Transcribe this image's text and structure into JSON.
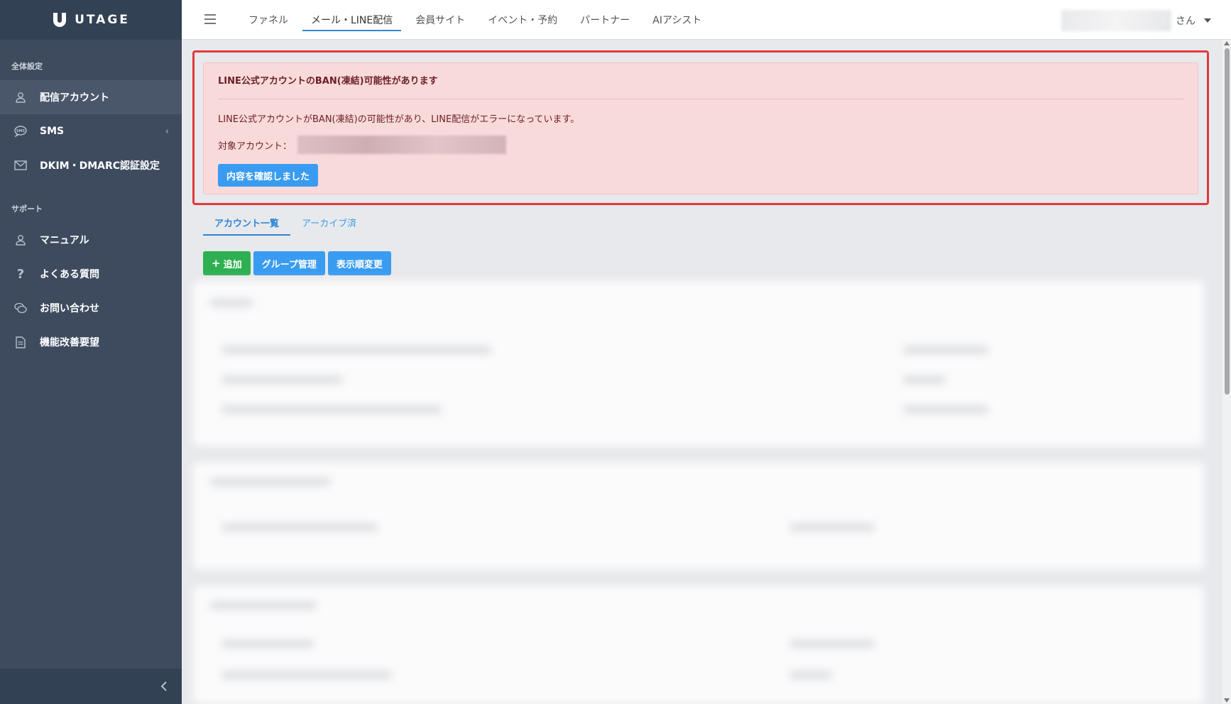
{
  "app": {
    "logo_text": "UTAGE"
  },
  "sidebar": {
    "section_general": "全体設定",
    "section_support": "サポート",
    "items": [
      {
        "label": "配信アカウント",
        "icon": "user-icon",
        "active": true
      },
      {
        "label": "SMS",
        "icon": "sms-icon"
      },
      {
        "label": "DKIM・DMARC認証設定",
        "icon": "envelope-icon"
      },
      {
        "label": "マニュアル",
        "icon": "user-icon"
      },
      {
        "label": "よくある質問",
        "icon": "question-icon"
      },
      {
        "label": "お問い合わせ",
        "icon": "chat-icon"
      },
      {
        "label": "機能改善要望",
        "icon": "document-icon"
      }
    ]
  },
  "header": {
    "nav": [
      {
        "label": "ファネル"
      },
      {
        "label": "メール・LINE配信",
        "active": true
      },
      {
        "label": "会員サイト"
      },
      {
        "label": "イベント・予約"
      },
      {
        "label": "パートナー"
      },
      {
        "label": "AIアシスト"
      }
    ],
    "user_suffix": "さん"
  },
  "alert": {
    "title": "LINE公式アカウントのBAN(凍結)可能性があります",
    "message": "LINE公式アカウントがBAN(凍結)の可能性があり、LINE配信がエラーになっています。",
    "account_label": "対象アカウント：",
    "confirm_button": "内容を確認しました"
  },
  "tabs": [
    {
      "label": "アカウント一覧",
      "active": true
    },
    {
      "label": "アーカイブ済"
    }
  ],
  "actions": {
    "add": "追加",
    "group": "グループ管理",
    "order": "表示順変更"
  },
  "colors": {
    "sidebar_bg": "#3e4b5f",
    "accent": "#3a9cf0",
    "alert_border": "#e03a3e",
    "alert_bg": "#f9dadb",
    "add_button": "#2eb052"
  }
}
